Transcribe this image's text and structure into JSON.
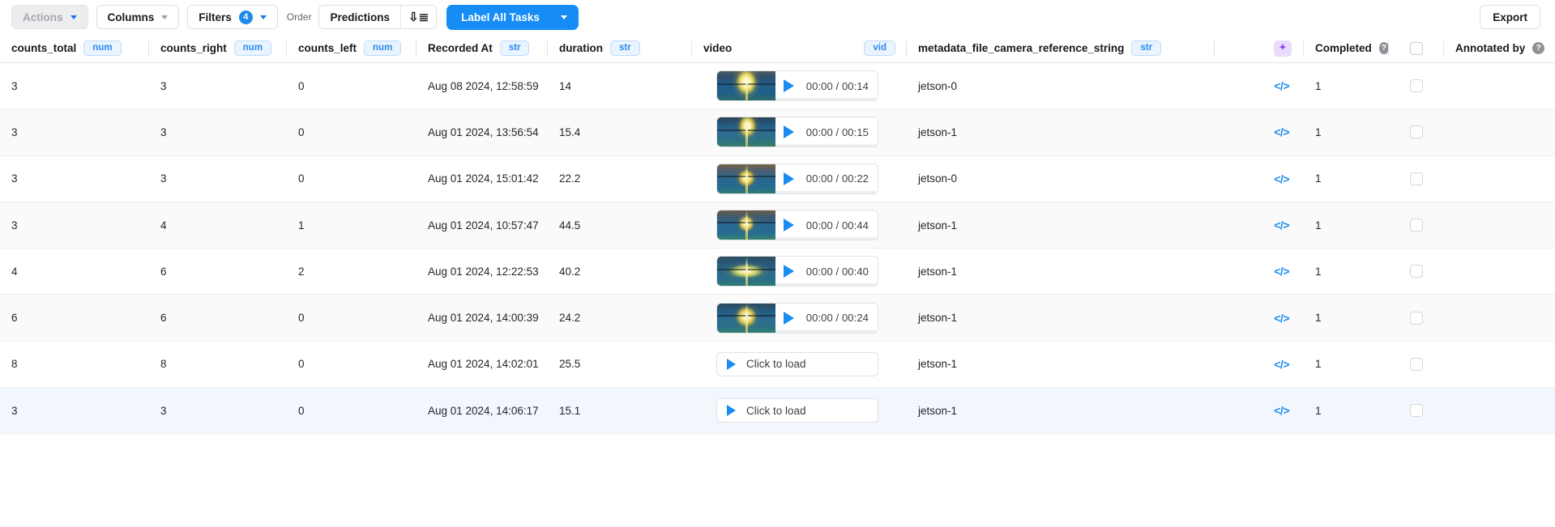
{
  "toolbar": {
    "actions_label": "Actions",
    "columns_label": "Columns",
    "filters_label": "Filters",
    "filters_count": "4",
    "order_label": "Order",
    "predictions_label": "Predictions",
    "sort_icon": "↓≡",
    "label_all_tasks_label": "Label All Tasks",
    "export_label": "Export",
    "accent_color": "#168cf5"
  },
  "table": {
    "columns": [
      {
        "key": "counts_total",
        "label": "counts_total",
        "type": "num"
      },
      {
        "key": "counts_right",
        "label": "counts_right",
        "type": "num"
      },
      {
        "key": "counts_left",
        "label": "counts_left",
        "type": "num"
      },
      {
        "key": "recorded_at",
        "label": "Recorded At",
        "type": "str"
      },
      {
        "key": "duration",
        "label": "duration",
        "type": "str"
      },
      {
        "key": "video",
        "label": "video",
        "type": "vid"
      },
      {
        "key": "metadata",
        "label": "metadata_file_camera_reference_string",
        "type": "str"
      },
      {
        "key": "sparkle",
        "label": "",
        "type": ""
      },
      {
        "key": "completed",
        "label": "Completed",
        "type": ""
      },
      {
        "key": "annotated_by",
        "label": "Annotated by",
        "type": ""
      }
    ],
    "rows": [
      {
        "counts_total": "3",
        "counts_right": "3",
        "counts_left": "0",
        "recorded_at": "Aug 08 2024, 12:58:59",
        "duration": "14",
        "video_state": "loaded",
        "video_time": "00:00 / 00:14",
        "metadata": "jetson-0",
        "completed": "1",
        "checked": false,
        "highlight": "none"
      },
      {
        "counts_total": "3",
        "counts_right": "3",
        "counts_left": "0",
        "recorded_at": "Aug 01 2024, 13:56:54",
        "duration": "15.4",
        "video_state": "loaded",
        "video_time": "00:00 / 00:15",
        "metadata": "jetson-1",
        "completed": "1",
        "checked": false,
        "highlight": "alt"
      },
      {
        "counts_total": "3",
        "counts_right": "3",
        "counts_left": "0",
        "recorded_at": "Aug 01 2024, 15:01:42",
        "duration": "22.2",
        "video_state": "loaded",
        "video_time": "00:00 / 00:22",
        "metadata": "jetson-0",
        "completed": "1",
        "checked": false,
        "highlight": "none"
      },
      {
        "counts_total": "3",
        "counts_right": "4",
        "counts_left": "1",
        "recorded_at": "Aug 01 2024, 10:57:47",
        "duration": "44.5",
        "video_state": "loaded",
        "video_time": "00:00 / 00:44",
        "metadata": "jetson-1",
        "completed": "1",
        "checked": false,
        "highlight": "alt"
      },
      {
        "counts_total": "4",
        "counts_right": "6",
        "counts_left": "2",
        "recorded_at": "Aug 01 2024, 12:22:53",
        "duration": "40.2",
        "video_state": "loaded",
        "video_time": "00:00 / 00:40",
        "metadata": "jetson-1",
        "completed": "1",
        "checked": false,
        "highlight": "none"
      },
      {
        "counts_total": "6",
        "counts_right": "6",
        "counts_left": "0",
        "recorded_at": "Aug 01 2024, 14:00:39",
        "duration": "24.2",
        "video_state": "loaded",
        "video_time": "00:00 / 00:24",
        "metadata": "jetson-1",
        "completed": "1",
        "checked": false,
        "highlight": "alt"
      },
      {
        "counts_total": "8",
        "counts_right": "8",
        "counts_left": "0",
        "recorded_at": "Aug 01 2024, 14:02:01",
        "duration": "25.5",
        "video_state": "unloaded",
        "video_time": "Click to load",
        "metadata": "jetson-1",
        "completed": "1",
        "checked": false,
        "highlight": "none"
      },
      {
        "counts_total": "3",
        "counts_right": "3",
        "counts_left": "0",
        "recorded_at": "Aug 01 2024, 14:06:17",
        "duration": "15.1",
        "video_state": "unloaded",
        "video_time": "Click to load",
        "metadata": "jetson-1",
        "completed": "1",
        "checked": false,
        "highlight": "hover"
      }
    ],
    "load_label": "Click to load",
    "help_glyph": "?",
    "sparkle_glyph": "✦",
    "code_glyph": "</>"
  }
}
